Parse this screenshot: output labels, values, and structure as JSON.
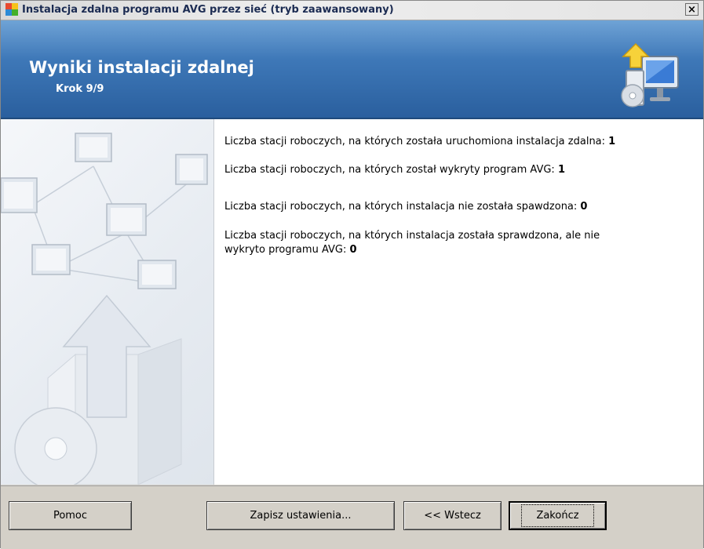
{
  "window": {
    "title": "Instalacja zdalna programu AVG przez sieć (tryb zaawansowany)",
    "close_label": "×"
  },
  "header": {
    "title": "Wyniki instalacji zdalnej",
    "step": "Krok 9/9"
  },
  "results": {
    "line1_text": "Liczba stacji roboczych, na których została uruchomiona instalacja zdalna: ",
    "line1_value": "1",
    "line2_text": "Liczba stacji roboczych, na których został wykryty program AVG: ",
    "line2_value": "1",
    "line3_text": "Liczba stacji roboczych, na których instalacja nie została spawdzona: ",
    "line3_value": "0",
    "line4_text_a": "Liczba stacji roboczych, na których instalacja została sprawdzona, ale nie",
    "line4_text_b": "wykryto programu AVG: ",
    "line4_value": "0"
  },
  "footer": {
    "help_label": "Pomoc",
    "save_label": "Zapisz ustawienia...",
    "back_label": "<< Wstecz",
    "finish_label": "Zakończ"
  },
  "icons": {
    "app": "avg-logo-icon",
    "header": "network-install-icon",
    "side": "network-computers-illustration"
  }
}
